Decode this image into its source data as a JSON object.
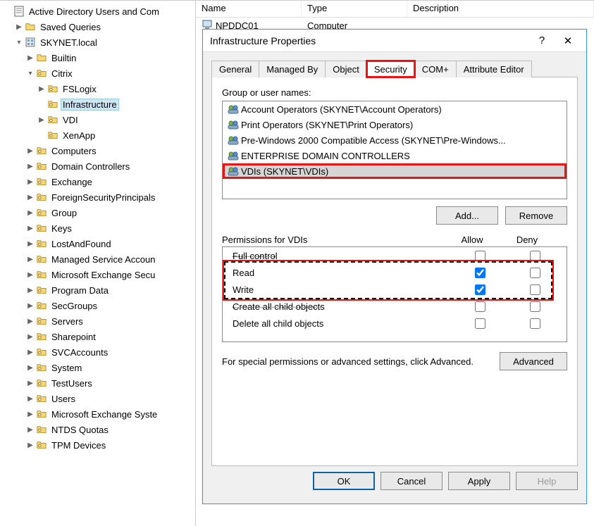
{
  "tree": {
    "root_label": "Active Directory Users and Com",
    "saved_queries_label": "Saved Queries",
    "domain_label": "SKYNET.local",
    "builtin_label": "Builtin",
    "citrix": {
      "label": "Citrix",
      "fslogix": "FSLogix",
      "infrastructure": "Infrastructure",
      "vdi": "VDI",
      "xenapp": "XenApp"
    },
    "nodes": [
      "Computers",
      "Domain Controllers",
      "Exchange",
      "ForeignSecurityPrincipals",
      "Group",
      "Keys",
      "LostAndFound",
      "Managed Service Accoun",
      "Microsoft Exchange Secu",
      "Program Data",
      "SecGroups",
      "Servers",
      "Sharepoint",
      "SVCAccounts",
      "System",
      "TestUsers",
      "Users",
      "Microsoft Exchange Syste",
      "NTDS Quotas",
      "TPM Devices"
    ]
  },
  "list": {
    "columns": {
      "name": "Name",
      "type": "Type",
      "description": "Description"
    },
    "row0": {
      "name": "NPDDC01",
      "type": "Computer",
      "description": ""
    }
  },
  "dialog": {
    "title": "Infrastructure Properties",
    "tabs": {
      "general": "General",
      "managed_by": "Managed By",
      "object": "Object",
      "security": "Security",
      "com_plus": "COM+",
      "attribute_editor": "Attribute Editor"
    },
    "group_label": "Group or user names:",
    "groups": [
      "Account Operators (SKYNET\\Account Operators)",
      "Print Operators (SKYNET\\Print Operators)",
      "Pre-Windows 2000 Compatible Access (SKYNET\\Pre-Windows...",
      "ENTERPRISE DOMAIN CONTROLLERS",
      "VDIs (SKYNET\\VDIs)"
    ],
    "add_label": "Add...",
    "remove_label": "Remove",
    "perm_header_label": "Permissions for VDIs",
    "allow_label": "Allow",
    "deny_label": "Deny",
    "permissions": [
      {
        "name": "Full control",
        "allow": false,
        "deny": false,
        "strike": true
      },
      {
        "name": "Read",
        "allow": true,
        "deny": false,
        "strike": false
      },
      {
        "name": "Write",
        "allow": true,
        "deny": false,
        "strike": false
      },
      {
        "name": "Create all child objects",
        "allow": false,
        "deny": false,
        "strike": true
      },
      {
        "name": "Delete all child objects",
        "allow": false,
        "deny": false,
        "strike": false
      }
    ],
    "advanced_text": "For special permissions or advanced settings, click Advanced.",
    "advanced_label": "Advanced",
    "ok_label": "OK",
    "cancel_label": "Cancel",
    "apply_label": "Apply",
    "help_label": "Help"
  }
}
